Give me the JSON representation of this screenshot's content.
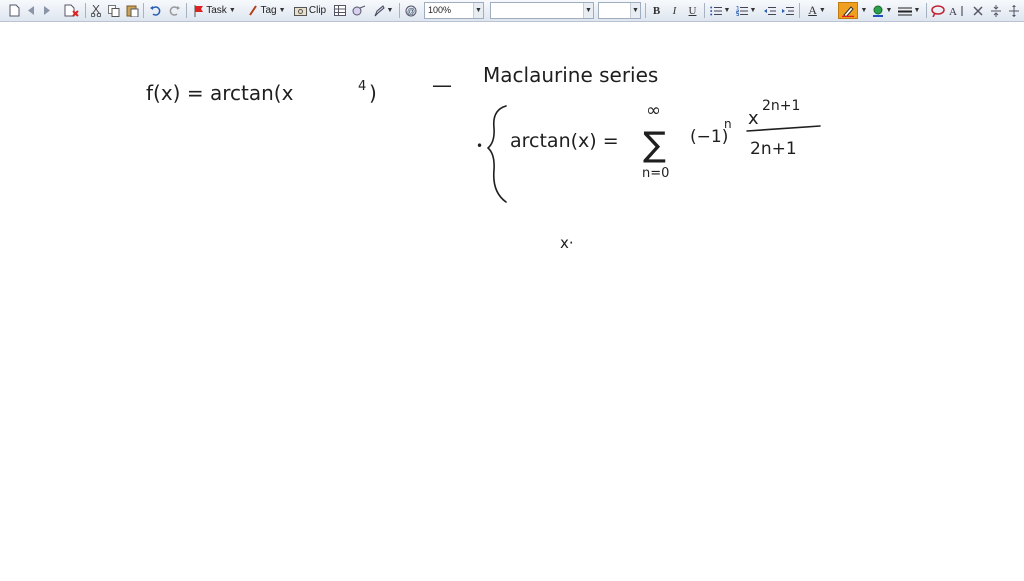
{
  "toolbar": {
    "task_label": "Task",
    "tag_label": "Tag",
    "clip_label": "Clip",
    "zoom_value": "100%",
    "font_name_value": "",
    "font_size_value": "",
    "bold_label": "B",
    "italic_label": "I",
    "underline_label": "U",
    "text_size_label": "A",
    "accent_color": "#f0a020"
  },
  "notes": {
    "line1_function": "f(x) = arctan(x",
    "line1_exponent": "4",
    "line1_close": ")",
    "line1_dash": "—",
    "line1_series": "Maclaurine series",
    "bullet": "•",
    "formula_lhs": "arctan(x) =",
    "sum_upper": "∞",
    "sum_symbol": "∑",
    "sum_lower": "n=0",
    "sign_term": "(−1)",
    "sign_exp": "n",
    "frac_num_base": "x",
    "frac_num_exp": "2n+1",
    "frac_den": "2n+1",
    "stray_mark": "x·"
  }
}
